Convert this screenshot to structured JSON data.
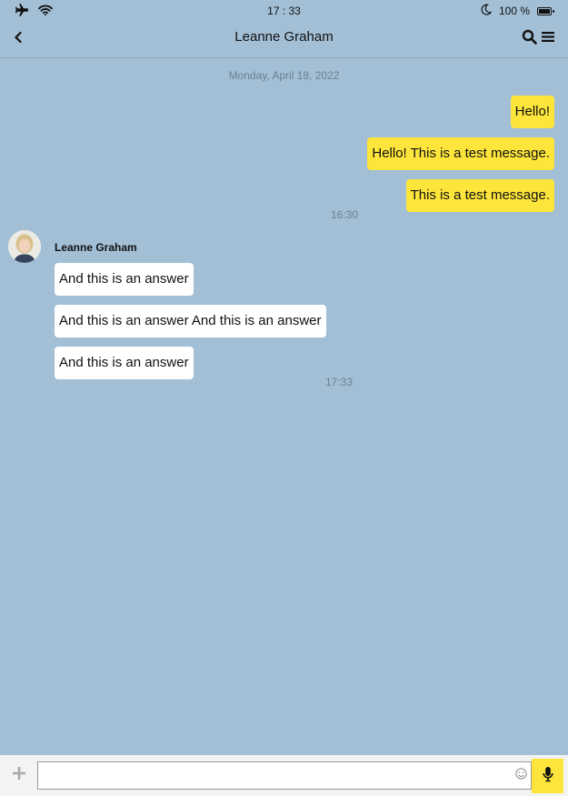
{
  "status_bar": {
    "time": "17 : 33",
    "battery": "100 %",
    "icons": [
      "airplane-icon",
      "wifi-icon",
      "moon-icon",
      "battery-icon"
    ]
  },
  "header": {
    "title": "Leanne Graham",
    "back_icon": "chevron-left-icon",
    "search_icon": "search-icon",
    "menu_icon": "menu-icon"
  },
  "conversation": {
    "date": "Monday, April 18, 2022",
    "outgoing": {
      "messages": [
        "Hello!",
        "Hello! This is a test message.",
        "This is a test message."
      ],
      "time": "16:30"
    },
    "incoming": {
      "sender": "Leanne Graham",
      "messages": [
        "And this is an answer",
        "And this is an answer And this is an answer",
        "And this is an answer"
      ],
      "time": "17:33"
    }
  },
  "composer": {
    "value": "",
    "placeholder": "",
    "attach_icon": "plus-icon",
    "emoji_icon": "emoji-icon",
    "mic_icon": "microphone-icon"
  },
  "colors": {
    "background": "#a2bfd6",
    "outgoing_bubble": "#fde53b",
    "incoming_bubble": "#ffffff",
    "mic_button": "#fde53b",
    "composer_bar": "#f3f3f3"
  }
}
